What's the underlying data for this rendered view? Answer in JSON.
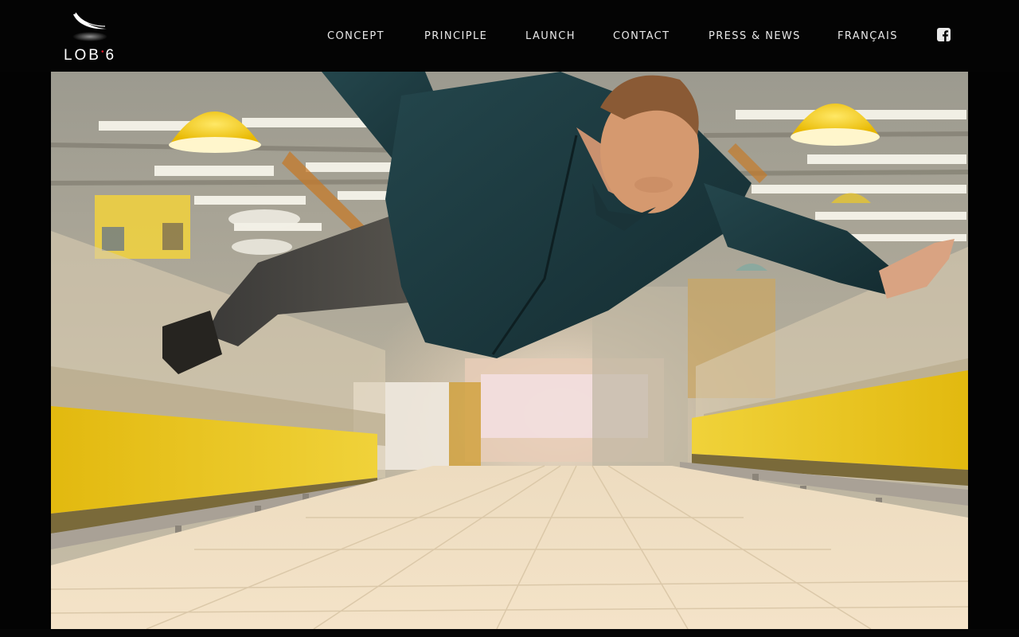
{
  "brand": {
    "logo_text_left": "LOB",
    "logo_text_dot": "•",
    "logo_text_right": "6"
  },
  "nav": {
    "items": [
      {
        "label": "CONCEPT"
      },
      {
        "label": "PRINCIPLE"
      },
      {
        "label": "LAUNCH"
      },
      {
        "label": "CONTACT"
      },
      {
        "label": "PRESS & NEWS"
      },
      {
        "label": "FRANÇAIS"
      }
    ],
    "social_icon": "facebook-icon"
  },
  "hero": {
    "subject": "person-levitating-in-supermarket-aisle-photo"
  },
  "colors": {
    "background": "#030303",
    "nav_text": "#e9e9e9",
    "logo_accent": "#d8192a",
    "freezer_yellow": "#e6c21a",
    "jacket_teal": "#1b3a40"
  }
}
